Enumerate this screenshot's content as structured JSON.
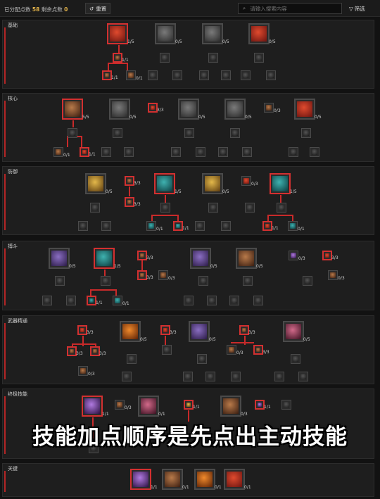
{
  "toolbar": {
    "allocated_label": "已分配点数",
    "allocated_value": "58",
    "remaining_label": "剩余点数",
    "remaining_value": "0",
    "reset_label": "重置",
    "search_placeholder": "请输入搜索内容",
    "filter_label": "筛选"
  },
  "overlay_caption": "技能加点顺序是先点出主动技能",
  "colors": {
    "accent": "#d33030",
    "points": "#e3b34a"
  },
  "sections": [
    {
      "title": "基础",
      "nodes": [
        {
          "label": "1/5",
          "active": true,
          "tone": "red"
        },
        {
          "label": "0/5",
          "active": false,
          "tone": "grey"
        },
        {
          "label": "0/5",
          "active": false,
          "tone": "grey"
        },
        {
          "label": "0/5",
          "active": false,
          "tone": "red"
        },
        {
          "label": "1/1",
          "active": true,
          "tone": "brown"
        },
        {
          "label": "1/1",
          "active": true,
          "tone": "brown"
        },
        {
          "label": "0/1",
          "active": false,
          "tone": "brown"
        }
      ]
    },
    {
      "title": "核心",
      "nodes": [
        {
          "label": "5/5",
          "active": true,
          "tone": "brown"
        },
        {
          "label": "0/5",
          "active": false,
          "tone": "grey"
        },
        {
          "label": "3/3",
          "active": true,
          "tone": "red"
        },
        {
          "label": "0/5",
          "active": false,
          "tone": "grey"
        },
        {
          "label": "0/5",
          "active": false,
          "tone": "grey"
        },
        {
          "label": "0/3",
          "active": false,
          "tone": "brown"
        },
        {
          "label": "0/5",
          "active": false,
          "tone": "red"
        },
        {
          "label": "0/1",
          "active": false,
          "tone": "brown"
        },
        {
          "label": "1/1",
          "active": true,
          "tone": "red"
        }
      ]
    },
    {
      "title": "防御",
      "nodes": [
        {
          "label": "0/5",
          "active": false,
          "tone": "gold"
        },
        {
          "label": "3/3",
          "active": true,
          "tone": "brown"
        },
        {
          "label": "3/3",
          "active": true,
          "tone": "brown"
        },
        {
          "label": "1/5",
          "active": true,
          "tone": "teal"
        },
        {
          "label": "0/5",
          "active": false,
          "tone": "gold"
        },
        {
          "label": "0/3",
          "active": false,
          "tone": "red"
        },
        {
          "label": "1/5",
          "active": true,
          "tone": "teal"
        },
        {
          "label": "0/1",
          "active": false,
          "tone": "teal"
        },
        {
          "label": "1/1",
          "active": true,
          "tone": "teal"
        },
        {
          "label": "1/1",
          "active": true,
          "tone": "red"
        },
        {
          "label": "0/1",
          "active": false,
          "tone": "teal"
        }
      ]
    },
    {
      "title": "搏斗",
      "nodes": [
        {
          "label": "0/5",
          "active": false,
          "tone": "purple"
        },
        {
          "label": "1/5",
          "active": true,
          "tone": "teal"
        },
        {
          "label": "0/5",
          "active": false,
          "tone": "purple"
        },
        {
          "label": "0/5",
          "active": false,
          "tone": "brown"
        },
        {
          "label": "0/3",
          "active": false,
          "tone": "violet"
        },
        {
          "label": "3/3",
          "active": true,
          "tone": "red"
        },
        {
          "label": "3/3",
          "active": true,
          "tone": "brown"
        },
        {
          "label": "0/3",
          "active": false,
          "tone": "brown"
        },
        {
          "label": "1/1",
          "active": true,
          "tone": "teal"
        },
        {
          "label": "0/1",
          "active": false,
          "tone": "teal"
        },
        {
          "label": "0/3",
          "active": false,
          "tone": "brown"
        },
        {
          "label": "3/3",
          "active": true,
          "tone": "brown"
        }
      ]
    },
    {
      "title": "武器精通",
      "nodes": [
        {
          "label": "3/3",
          "active": true,
          "tone": "red"
        },
        {
          "label": "3/3",
          "active": true,
          "tone": "brown"
        },
        {
          "label": "3/3",
          "active": true,
          "tone": "brown"
        },
        {
          "label": "0/3",
          "active": false,
          "tone": "brown"
        },
        {
          "label": "0/5",
          "active": false,
          "tone": "orange"
        },
        {
          "label": "3/3",
          "active": true,
          "tone": "red"
        },
        {
          "label": "0/5",
          "active": false,
          "tone": "purple"
        },
        {
          "label": "3/3",
          "active": true,
          "tone": "brown"
        },
        {
          "label": "3/3",
          "active": true,
          "tone": "brown"
        },
        {
          "label": "0/3",
          "active": false,
          "tone": "brown"
        },
        {
          "label": "0/5",
          "active": false,
          "tone": "pink"
        }
      ]
    },
    {
      "title": "终极技能",
      "nodes": [
        {
          "label": "1/1",
          "active": true,
          "tone": "violet"
        },
        {
          "label": "0/3",
          "active": false,
          "tone": "brown"
        },
        {
          "label": "0/1",
          "active": false,
          "tone": "pink"
        },
        {
          "label": "1/1",
          "active": true,
          "tone": "gold"
        },
        {
          "label": "0/3",
          "active": false,
          "tone": "brown"
        },
        {
          "label": "1/1",
          "active": true,
          "tone": "violet"
        }
      ]
    },
    {
      "title": "关键",
      "nodes": [
        {
          "label": "1/1",
          "active": true,
          "tone": "violet"
        },
        {
          "label": "0/1",
          "active": false,
          "tone": "brown"
        },
        {
          "label": "0/1",
          "active": false,
          "tone": "orange"
        },
        {
          "label": "0/1",
          "active": false,
          "tone": "red"
        }
      ]
    }
  ]
}
